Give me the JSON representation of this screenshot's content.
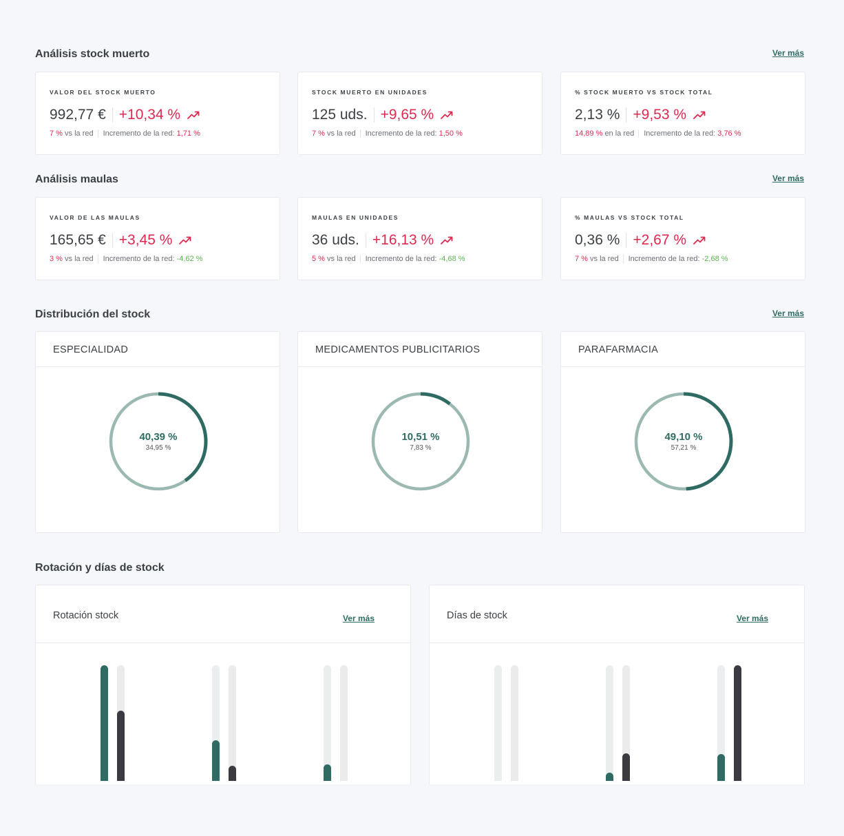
{
  "colors": {
    "accent": "#2f6b62",
    "negative_red": "#e0284f",
    "positive_green": "#5bb450",
    "ring_light": "#9cb8b3",
    "bar_dark": "#3a3b40"
  },
  "stock_muerto": {
    "title": "Análisis stock muerto",
    "ver_mas": "Ver más",
    "cards": [
      {
        "label": "VALOR DEL STOCK MUERTO",
        "value": "992,77 €",
        "delta": "+10,34 %",
        "trend_icon": "trending-up-icon",
        "compare": "7 %",
        "compare_text": "vs la red",
        "net_label": "Incremento de la red:",
        "net_value": "1,71 %"
      },
      {
        "label": "STOCK MUERTO EN UNIDADES",
        "value": "125 uds.",
        "delta": "+9,65 %",
        "trend_icon": "trending-up-icon",
        "compare": "7 %",
        "compare_text": "vs la red",
        "net_label": "Incremento de la red:",
        "net_value": "1,50 %"
      },
      {
        "label": "% STOCK MUERTO VS STOCK TOTAL",
        "value": "2,13 %",
        "delta": "+9,53 %",
        "trend_icon": "trending-up-icon",
        "compare": "14,89 %",
        "compare_text": "en la red",
        "net_label": "Incremento de la red:",
        "net_value": "3,76 %"
      }
    ]
  },
  "maulas": {
    "title": "Análisis maulas",
    "ver_mas": "Ver más",
    "cards": [
      {
        "label": "VALOR DE LAS MAULAS",
        "value": "165,65 €",
        "delta": "+3,45 %",
        "trend_icon": "trending-up-icon",
        "compare": "3 %",
        "compare_text": "vs la red",
        "net_label": "Incremento de la red:",
        "net_value": "-4,62 %"
      },
      {
        "label": "MAULAS EN UNIDADES",
        "value": "36 uds.",
        "delta": "+16,13 %",
        "trend_icon": "trending-up-icon",
        "compare": "5 %",
        "compare_text": "vs la red",
        "net_label": "Incremento de la red:",
        "net_value": "-4,68 %"
      },
      {
        "label": "% MAULAS VS STOCK TOTAL",
        "value": "0,36 %",
        "delta": "+2,67 %",
        "trend_icon": "trending-up-icon",
        "compare": "7 %",
        "compare_text": "vs la red",
        "net_label": "Incremento de la red:",
        "net_value": "-2,68 %"
      }
    ]
  },
  "distribucion": {
    "title": "Distribución del stock",
    "ver_mas": "Ver más",
    "cards": [
      {
        "label": "ESPECIALIDAD",
        "percent": "40,39 %",
        "secondary": "34,95 %",
        "fraction": 0.4039
      },
      {
        "label": "MEDICAMENTOS PUBLICITARIOS",
        "percent": "10,51 %",
        "secondary": "7,83 %",
        "fraction": 0.1051
      },
      {
        "label": "PARAFARMACIA",
        "percent": "49,10 %",
        "secondary": "57,21 %",
        "fraction": 0.491
      }
    ]
  },
  "rotacion": {
    "title": "Rotación y días de stock",
    "cards": [
      {
        "title": "Rotación stock",
        "ver_mas": "Ver más",
        "groups": [
          {
            "teal": 1.0,
            "dark": 0.61
          },
          {
            "teal": 0.35,
            "dark": 0.13
          },
          {
            "teal": 0.14,
            "dark": 0.0
          }
        ]
      },
      {
        "title": "Días de stock",
        "ver_mas": "Ver más",
        "groups": [
          {
            "teal": 0.0,
            "dark": 0.0
          },
          {
            "teal": 0.07,
            "dark": 0.24
          },
          {
            "teal": 0.23,
            "dark": 1.0
          }
        ]
      }
    ]
  }
}
